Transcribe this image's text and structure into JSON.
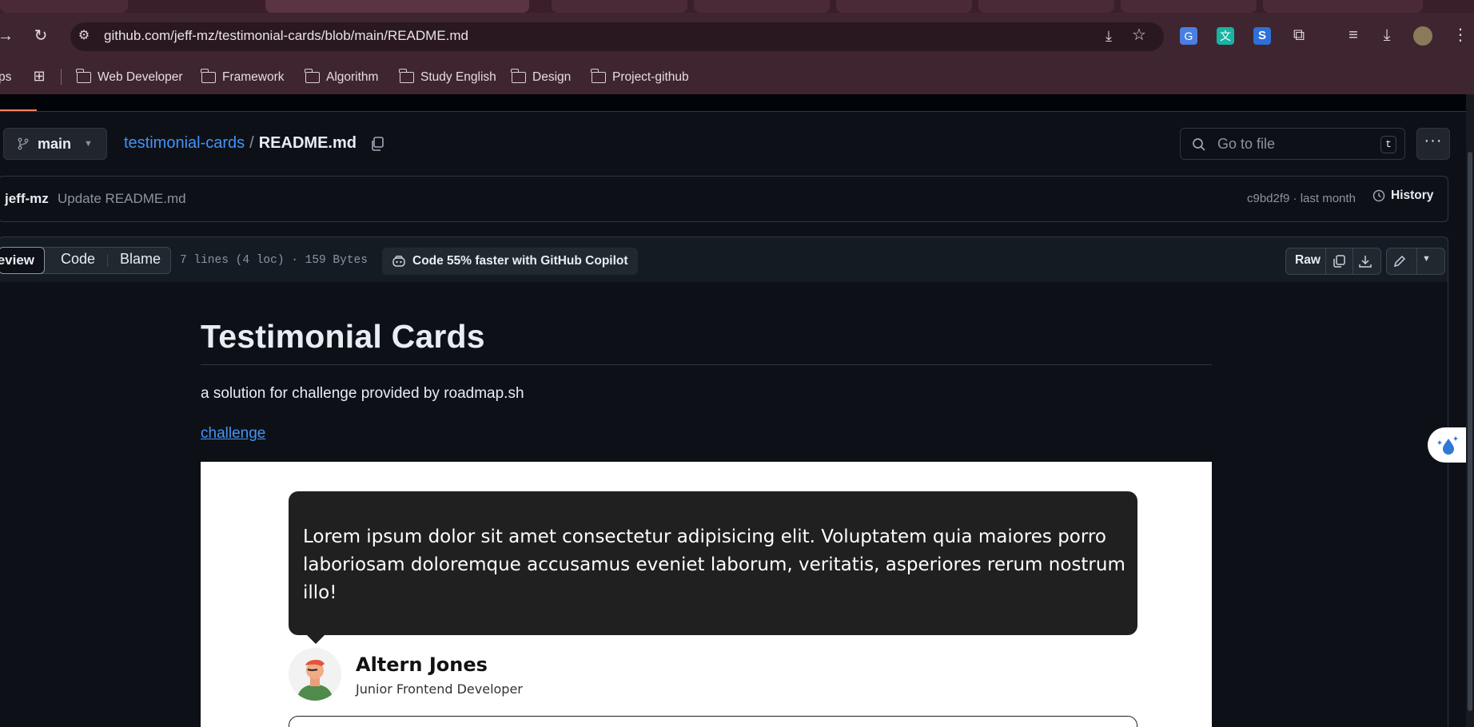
{
  "browser": {
    "url": "github.com/jeff-mz/testimonial-cards/blob/main/README.md",
    "bookmarks": [
      {
        "label": "ps"
      },
      {
        "label": "Web Developer"
      },
      {
        "label": "Framework"
      },
      {
        "label": "Algorithm"
      },
      {
        "label": "Study English"
      },
      {
        "label": "Design"
      },
      {
        "label": "Project-github"
      }
    ]
  },
  "repo": {
    "branch": "main",
    "repo_name": "testimonial-cards",
    "separator": "/",
    "file_name": "README.md",
    "goto_placeholder": "Go to file",
    "goto_shortcut": "t"
  },
  "commit": {
    "author": "jeff-mz",
    "message": "Update README.md",
    "meta": "c9bd2f9 · last month",
    "history_label": "History"
  },
  "viewbar": {
    "preview_label": "Preview",
    "code_label": "Code",
    "blame_label": "Blame",
    "file_info": "7 lines (4 loc) · 159 Bytes",
    "copilot_label": "Code 55% faster with GitHub Copilot",
    "raw_label": "Raw"
  },
  "readme": {
    "title": "Testimonial Cards",
    "description": "a solution for challenge provided by roadmap.sh",
    "link_text": "challenge",
    "card": {
      "quote": "Lorem ipsum dolor sit amet consectetur adipisicing elit. Voluptatem quia maiores porro laboriosam doloremque accusamus eveniet laborum, veritatis, asperiores rerum nostrum illo!",
      "name": "Altern Jones",
      "role": "Junior Frontend Developer"
    }
  },
  "colors": {
    "page_bg": "#0d1117",
    "link": "#4493f8",
    "border": "#30363d",
    "browser_toolbar": "#3f2530"
  }
}
